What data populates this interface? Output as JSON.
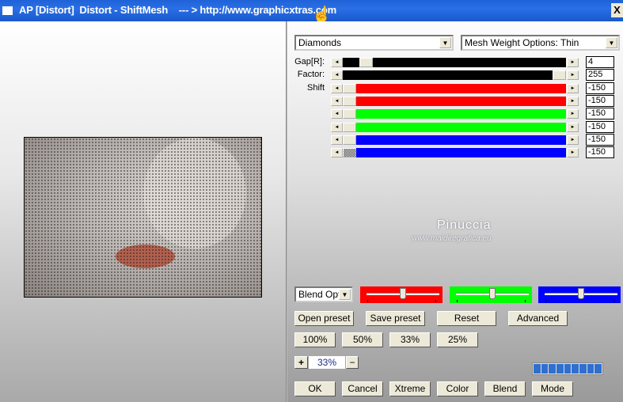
{
  "window": {
    "title": "AP [Distort]  Distort - ShiftMesh    --- > http://www.graphicxtras.com",
    "close_label": "X"
  },
  "top": {
    "pattern_select": "Diamonds",
    "mesh_select": "Mesh Weight Options: Thin"
  },
  "sliders": [
    {
      "label": "Gap[R]:",
      "value": "4",
      "fraction": 0.08,
      "color": "#000000"
    },
    {
      "label": "Factor:",
      "value": "255",
      "fraction": 1.0,
      "color": "#000000"
    },
    {
      "label": "Shift",
      "value": "-150",
      "fraction": 0,
      "color": "#ff0000"
    },
    {
      "label": "",
      "value": "-150",
      "fraction": 0,
      "color": "#ff0000"
    },
    {
      "label": "",
      "value": "-150",
      "fraction": 0,
      "color": "#00ff00"
    },
    {
      "label": "",
      "value": "-150",
      "fraction": 0,
      "color": "#00ff00"
    },
    {
      "label": "",
      "value": "-150",
      "fraction": 0,
      "color": "#0000ff"
    },
    {
      "label": "",
      "value": "-150",
      "fraction": 0,
      "color": "#0000ff"
    }
  ],
  "watermark": {
    "name": "Pinuccia",
    "site": "www.maidiregrafica.eu"
  },
  "blend": {
    "select": "Blend Optio",
    "color_sliders": [
      {
        "color": "#ff0000",
        "fraction": 0.5
      },
      {
        "color": "#00ff00",
        "fraction": 0.5
      },
      {
        "color": "#0000ff",
        "fraction": 0.5
      }
    ]
  },
  "buttons": {
    "open_preset": "Open preset",
    "save_preset": "Save preset",
    "reset": "Reset",
    "advanced": "Advanced",
    "p100": "100%",
    "p50": "50%",
    "p33": "33%",
    "p25": "25%",
    "ok": "OK",
    "cancel": "Cancel",
    "xtreme": "Xtreme",
    "color": "Color",
    "blend": "Blend",
    "mode": "Mode"
  },
  "zoom": {
    "plus": "+",
    "minus": "−",
    "value": "33%"
  },
  "progress": {
    "segments": 9,
    "filled": 9
  }
}
